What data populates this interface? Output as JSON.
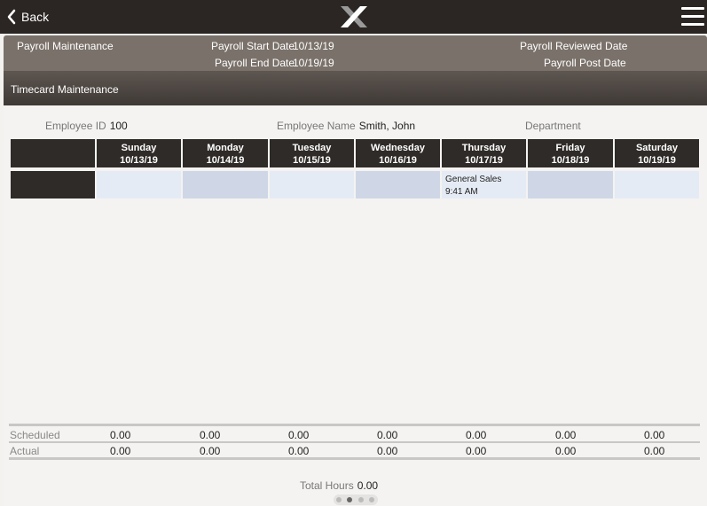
{
  "topbar": {
    "back_label": "Back"
  },
  "payroll": {
    "title": "Payroll Maintenance",
    "start_label": "Payroll Start Date",
    "start_value": "10/13/19",
    "end_label": "Payroll End Date",
    "end_value": "10/19/19",
    "reviewed_label": "Payroll Reviewed Date",
    "post_label": "Payroll Post Date"
  },
  "section_title": "Timecard Maintenance",
  "employee": {
    "id_label": "Employee ID",
    "id_value": "100",
    "name_label": "Employee Name",
    "name_value": "Smith, John",
    "dept_label": "Department"
  },
  "days": [
    {
      "name": "Sunday",
      "date": "10/13/19"
    },
    {
      "name": "Monday",
      "date": "10/14/19"
    },
    {
      "name": "Tuesday",
      "date": "10/15/19"
    },
    {
      "name": "Wednesday",
      "date": "10/16/19"
    },
    {
      "name": "Thursday",
      "date": "10/17/19"
    },
    {
      "name": "Friday",
      "date": "10/18/19"
    },
    {
      "name": "Saturday",
      "date": "10/19/19"
    }
  ],
  "entries": {
    "thursday": {
      "job": "General Sales",
      "time": "9:41 AM"
    }
  },
  "scheduled": {
    "label": "Scheduled",
    "values": [
      "0.00",
      "0.00",
      "0.00",
      "0.00",
      "0.00",
      "0.00",
      "0.00"
    ]
  },
  "actual": {
    "label": "Actual",
    "values": [
      "0.00",
      "0.00",
      "0.00",
      "0.00",
      "0.00",
      "0.00",
      "0.00"
    ]
  },
  "total": {
    "label": "Total Hours",
    "value": "0.00"
  },
  "colors": {
    "topbar": "#2b2623",
    "header_band": "#7a716a",
    "grid_header": "#2f2b28",
    "cell_light": "#e5ebf4",
    "cell_mid": "#cfd7e7"
  }
}
